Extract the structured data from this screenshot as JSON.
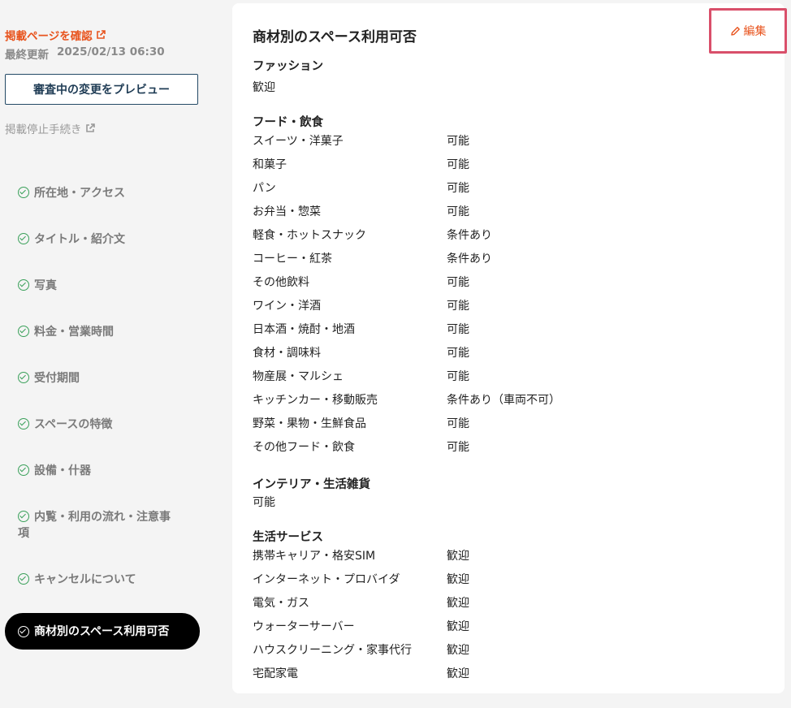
{
  "sidebar": {
    "view_link": "掲載ページを確認",
    "updated_label": "最終更新",
    "updated_value": "2025/02/13 06:30",
    "preview_button": "審査中の変更をプレビュー",
    "stop_link": "掲載停止手続き",
    "nav": [
      "所在地・アクセス",
      "タイトル・紹介文",
      "写真",
      "料金・営業時間",
      "受付期間",
      "スペースの特徴",
      "設備・什器",
      "内覧・利用の流れ・注意事項",
      "キャンセルについて",
      "商材別のスペース利用可否"
    ],
    "active_index": 9
  },
  "main": {
    "title": "商材別のスペース利用可否",
    "edit_label": "編集",
    "fashion": {
      "title": "ファッション",
      "value": "歓迎"
    },
    "food": {
      "title": "フード・飲食",
      "rows": [
        [
          "スイーツ・洋菓子",
          "可能"
        ],
        [
          "和菓子",
          "可能"
        ],
        [
          "パン",
          "可能"
        ],
        [
          "お弁当・惣菜",
          "可能"
        ],
        [
          "軽食・ホットスナック",
          "条件あり"
        ],
        [
          "コーヒー・紅茶",
          "条件あり"
        ],
        [
          "その他飲料",
          "可能"
        ],
        [
          "ワイン・洋酒",
          "可能"
        ],
        [
          "日本酒・焼酎・地酒",
          "可能"
        ],
        [
          "食材・調味料",
          "可能"
        ],
        [
          "物産展・マルシェ",
          "可能"
        ],
        [
          "キッチンカー・移動販売",
          "条件あり（車両不可）"
        ],
        [
          "野菜・果物・生鮮食品",
          "可能"
        ],
        [
          "その他フード・飲食",
          "可能"
        ]
      ]
    },
    "interior": {
      "title": "インテリア・生活雑貨",
      "value": "可能"
    },
    "service": {
      "title": "生活サービス",
      "rows": [
        [
          "携帯キャリア・格安SIM",
          "歓迎"
        ],
        [
          "インターネット・プロバイダ",
          "歓迎"
        ],
        [
          "電気・ガス",
          "歓迎"
        ],
        [
          "ウォーターサーバー",
          "歓迎"
        ],
        [
          "ハウスクリーニング・家事代行",
          "歓迎"
        ],
        [
          "宅配家電",
          "歓迎"
        ]
      ]
    }
  }
}
